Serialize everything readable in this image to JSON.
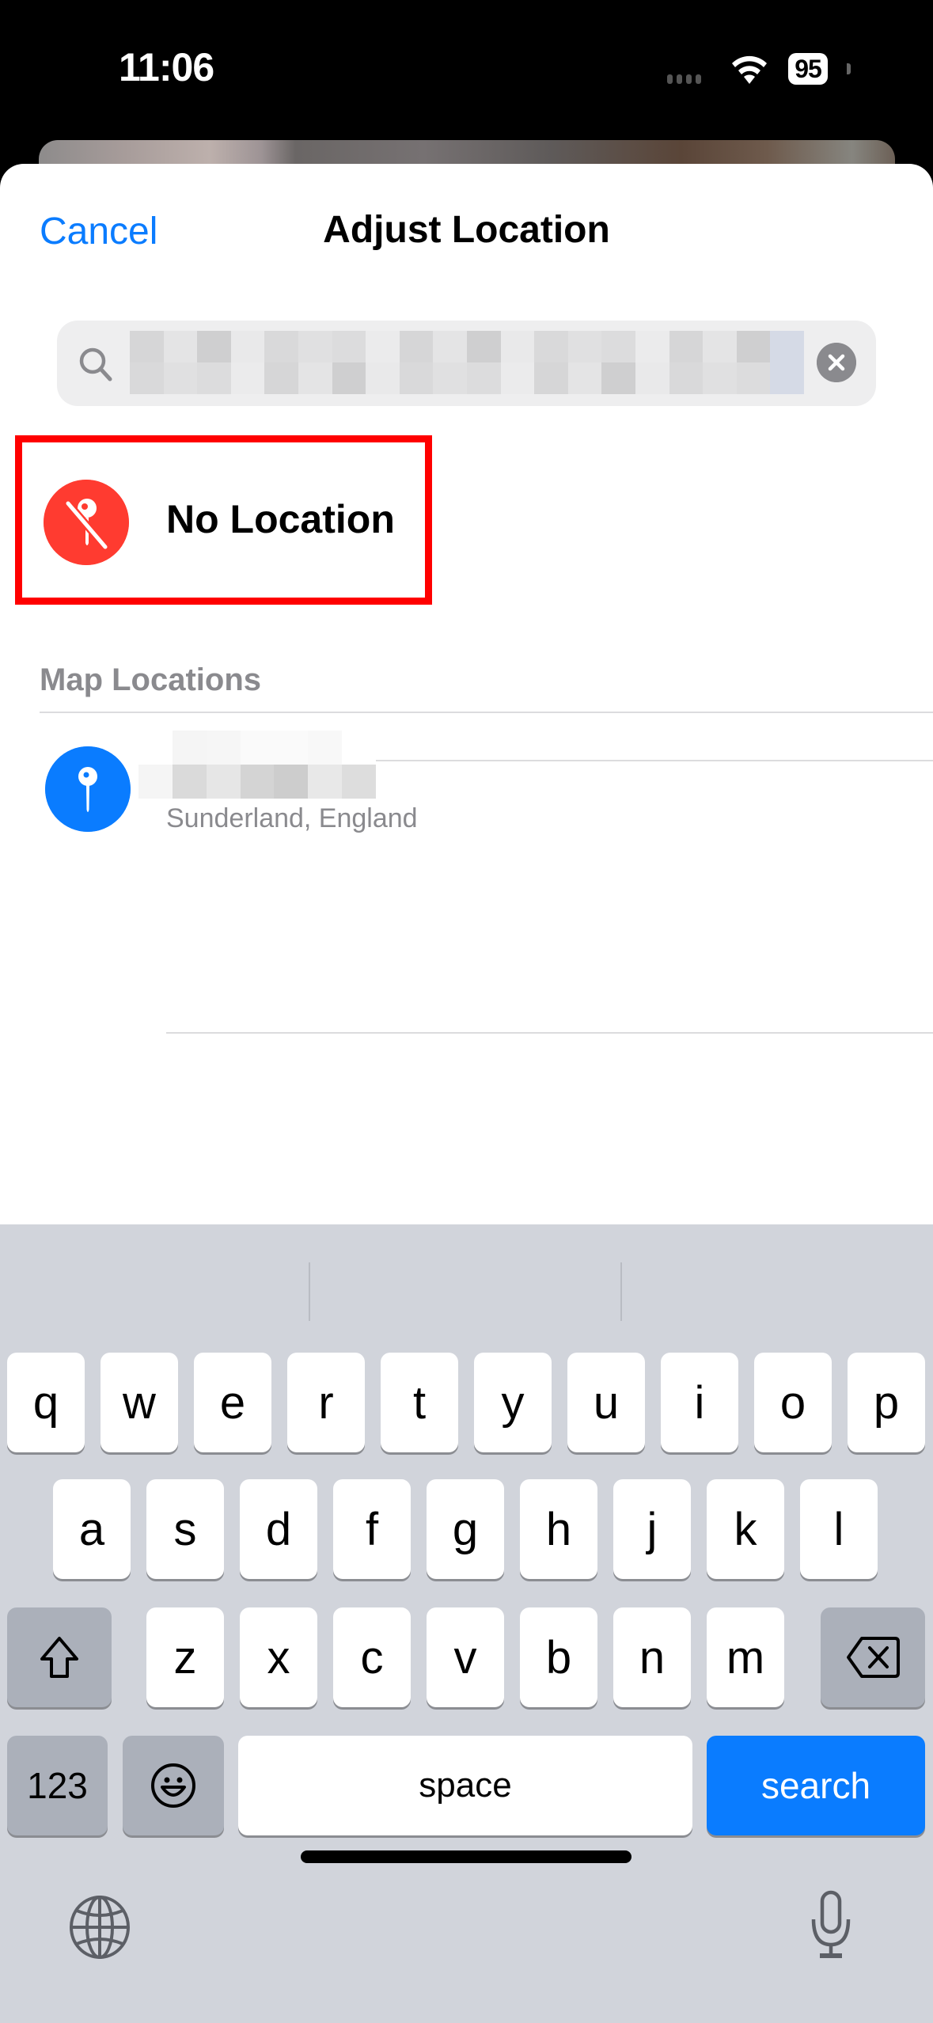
{
  "status_bar": {
    "time": "11:06",
    "battery": "95",
    "icons": [
      "cellular-signal-icon",
      "wifi-icon",
      "battery-icon"
    ]
  },
  "sheet": {
    "cancel_label": "Cancel",
    "title": "Adjust Location",
    "search": {
      "value": "[redacted]",
      "icons": {
        "leading": "magnifying-glass-icon",
        "trailing": "clear-x-icon"
      }
    },
    "no_location": {
      "label": "No Location",
      "icon": "location-slash-pin-icon",
      "highlighted": true
    },
    "section_header": "Map Locations",
    "map_locations": [
      {
        "title": "[redacted]",
        "subtitle": "Sunderland, England",
        "icon": "map-pin-icon"
      }
    ]
  },
  "keyboard": {
    "row1": [
      "q",
      "w",
      "e",
      "r",
      "t",
      "y",
      "u",
      "i",
      "o",
      "p"
    ],
    "row2": [
      "a",
      "s",
      "d",
      "f",
      "g",
      "h",
      "j",
      "k",
      "l"
    ],
    "row3": [
      "z",
      "x",
      "c",
      "v",
      "b",
      "n",
      "m"
    ],
    "numbers_label": "123",
    "space_label": "space",
    "action_label": "search",
    "icons": [
      "shift-icon",
      "backspace-icon",
      "emoji-icon",
      "globe-icon",
      "microphone-icon"
    ]
  },
  "colors": {
    "accent": "#0a7cff",
    "destructive": "#ff3b30",
    "highlight_box": "#ff0000",
    "keyboard_bg": "#d1d4db",
    "secondary_text": "#8a8a8e"
  }
}
